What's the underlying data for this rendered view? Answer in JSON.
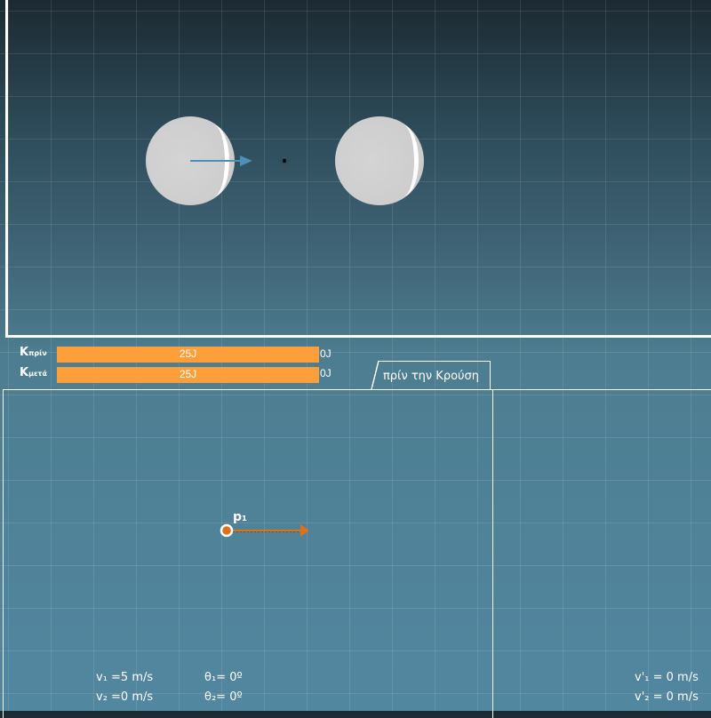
{
  "energy": {
    "before_label_main": "K",
    "before_label_sub": "πρίν",
    "after_label_main": "K",
    "after_label_sub": "μετά",
    "before_value": "25J",
    "after_value": "25J",
    "before_end": "0J",
    "after_end": "0J",
    "before_fill_fraction": 1.0,
    "after_fill_fraction": 1.0
  },
  "tab": {
    "label": "πρίν την Κρούση"
  },
  "momentum": {
    "label": "p₁"
  },
  "readouts": {
    "v1": "v₁ =5 m/s",
    "v2": "v₂ =0 m/s",
    "theta1": "θ₁= 0º",
    "theta2": "θ₂= 0º",
    "v1_after": "v'₁ = 0 m/s",
    "v2_after": "v'₂ = 0 m/s"
  },
  "colors": {
    "bar": "#ff9f3a",
    "velocity_arrow": "#4a90b8",
    "momentum_arrow": "#e0701a"
  }
}
